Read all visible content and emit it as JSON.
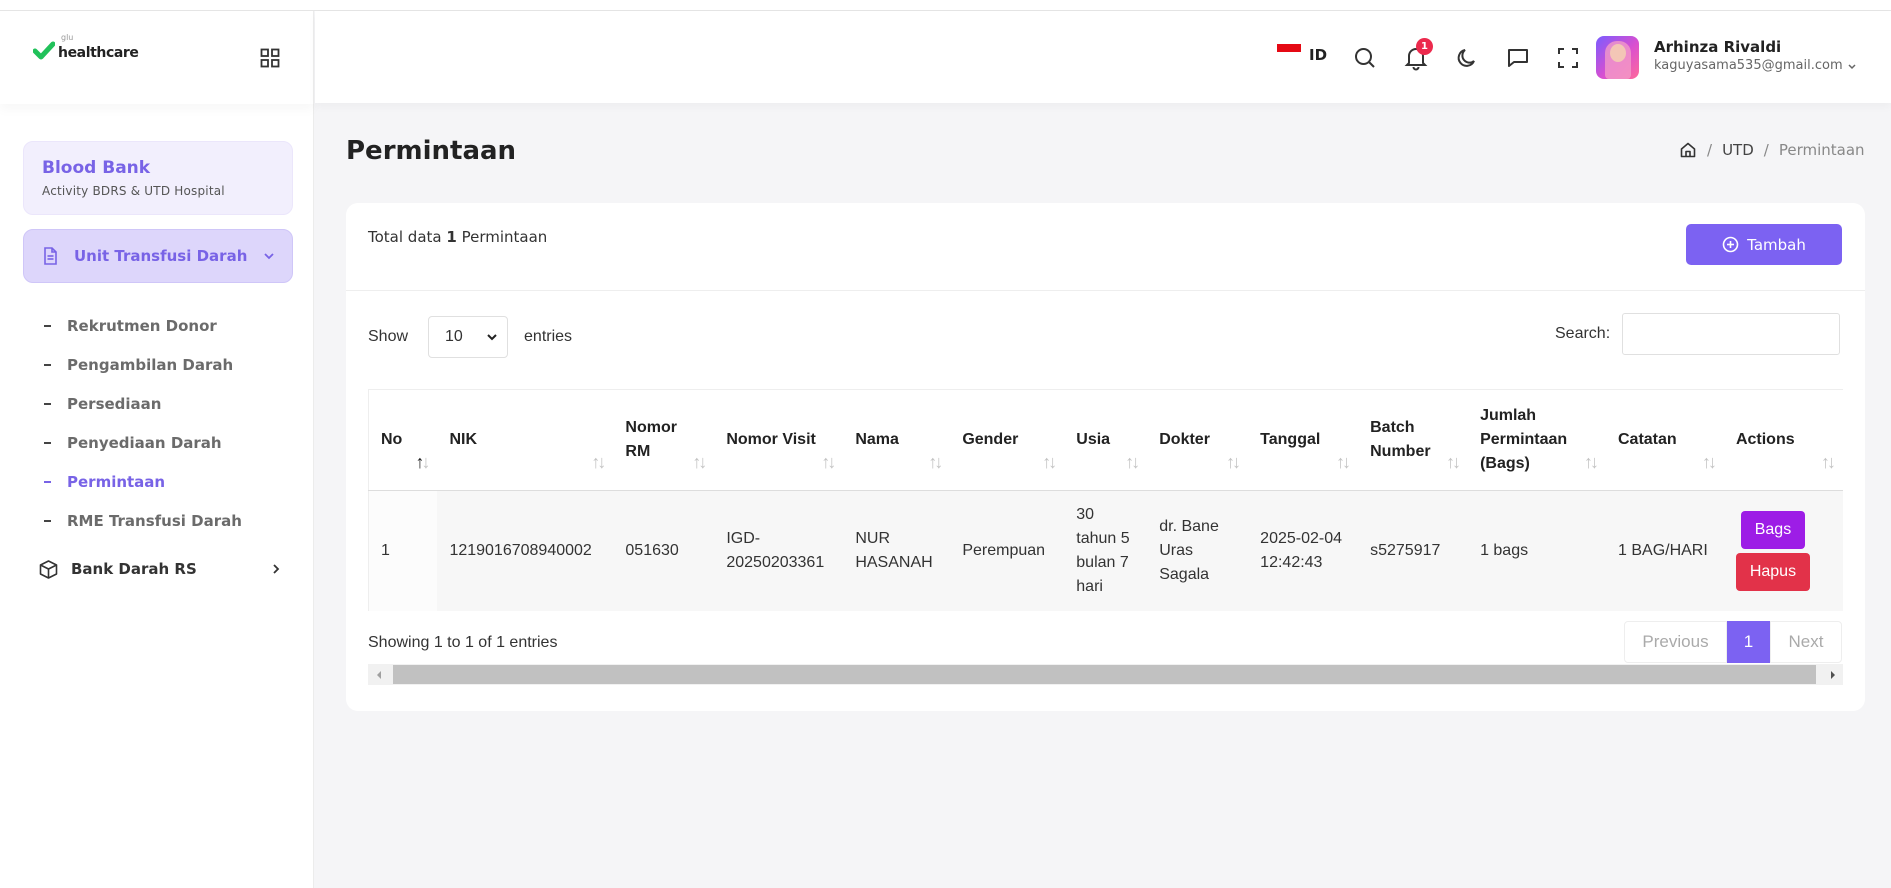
{
  "brand": {
    "small": "glu",
    "name": "healthcare"
  },
  "sidebar": {
    "card_title": "Blood Bank",
    "card_subtitle": "Activity BDRS & UTD Hospital",
    "active_menu": "Unit Transfusi Darah",
    "submenu": [
      {
        "label": "Rekrutmen Donor"
      },
      {
        "label": "Pengambilan Darah"
      },
      {
        "label": "Persediaan"
      },
      {
        "label": "Penyediaan Darah"
      },
      {
        "label": "Permintaan"
      },
      {
        "label": "RME Transfusi Darah"
      }
    ],
    "menu_bank": "Bank Darah RS"
  },
  "header": {
    "lang": "ID",
    "notif_count": "1",
    "user_name": "Arhinza Rivaldi",
    "user_email": "kaguyasama535@gmail.com"
  },
  "page": {
    "title": "Permintaan",
    "breadcrumb": [
      "UTD",
      "Permintaan"
    ]
  },
  "card": {
    "total_prefix": "Total data",
    "total_count": "1",
    "total_suffix": "Permintaan",
    "add_label": "Tambah",
    "show_label": "Show",
    "entries_value": "10",
    "entries_label": "entries",
    "search_label": "Search:",
    "search_value": ""
  },
  "table": {
    "headers": [
      "No",
      "NIK",
      "Nomor RM",
      "Nomor Visit",
      "Nama",
      "Gender",
      "Usia",
      "Dokter",
      "Tanggal",
      "Batch Number",
      "Jumlah Permintaan (Bags)",
      "Catatan",
      "Actions"
    ],
    "rows": [
      {
        "no": "1",
        "nik": "1219016708940002",
        "nomor_rm": "051630",
        "nomor_visit": "IGD-20250203361",
        "nama": "NUR HASANAH",
        "gender": "Perempuan",
        "usia": "30 tahun 5 bulan 7 hari",
        "dokter": "dr. Bane Uras Sagala",
        "tanggal": "2025-02-04 12:42:43",
        "batch": "s5275917",
        "jumlah": "1 bags",
        "catatan": "1 BAG/HARI",
        "btn_bags": "Bags",
        "btn_hapus": "Hapus"
      }
    ]
  },
  "footer": {
    "info": "Showing 1 to 1 of 1 entries",
    "prev": "Previous",
    "page": "1",
    "next": "Next"
  },
  "colors": {
    "primary": "#7c62f2",
    "bags": "#9d1de6",
    "hapus": "#e23249",
    "badge": "#ec2a4d"
  }
}
